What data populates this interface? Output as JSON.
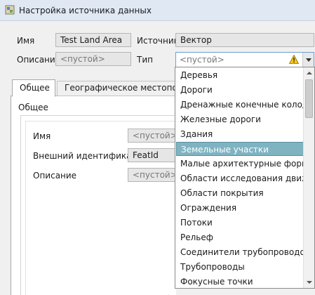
{
  "window": {
    "title": "Настройка источника данных"
  },
  "top_form": {
    "name_label": "Имя",
    "name_value": "Test Land Area",
    "source_label": "Источник",
    "source_value": "Вектор",
    "description_label": "Описание",
    "description_placeholder": "<пустой>",
    "type_label": "Тип",
    "type_value": "<пустой>"
  },
  "tabs": [
    {
      "label": "Общее",
      "active": true
    },
    {
      "label": "Географическое местоположение",
      "active": false
    }
  ],
  "general": {
    "group_title": "Общее",
    "name_label": "Имя",
    "name_placeholder": "<пустой>",
    "external_id_label": "Внешний идентификатор",
    "external_id_value": "FeatId",
    "description_label": "Описание",
    "description_placeholder": "<пустой>"
  },
  "type_dropdown": {
    "selected_index": 5,
    "selected_color": "#7fb3c2",
    "scroll_fraction": 0.0,
    "items": [
      "Деревья",
      "Дороги",
      "Дренажные конечные колодцы",
      "Железные дороги",
      "Здания",
      "Земельные участки",
      "Малые архитектурные формы",
      "Области исследования движения",
      "Области покрытия",
      "Ограждения",
      "Потоки",
      "Рельеф",
      "Соединители трубопроводов",
      "Трубопроводы",
      "Фокусные точки"
    ]
  },
  "icons": {
    "app": "data-source-icon",
    "warning": "warning-icon"
  }
}
